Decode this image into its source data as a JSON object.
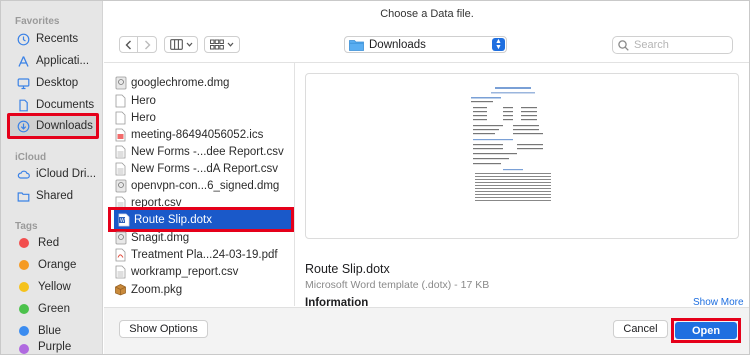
{
  "dialog": {
    "title": "Choose a Data file."
  },
  "sidebar": {
    "favorites_header": "Favorites",
    "favorites": [
      {
        "label": "Recents",
        "icon": "clock-icon"
      },
      {
        "label": "Applicati...",
        "icon": "applications-icon"
      },
      {
        "label": "Desktop",
        "icon": "desktop-icon"
      },
      {
        "label": "Documents",
        "icon": "document-icon"
      },
      {
        "label": "Downloads",
        "icon": "download-icon",
        "selected": true
      }
    ],
    "icloud_header": "iCloud",
    "icloud": [
      {
        "label": "iCloud Dri...",
        "icon": "cloud-icon"
      },
      {
        "label": "Shared",
        "icon": "shared-folder-icon"
      }
    ],
    "tags_header": "Tags",
    "tags": [
      {
        "label": "Red",
        "color": "#f24e4e"
      },
      {
        "label": "Orange",
        "color": "#f59a23"
      },
      {
        "label": "Yellow",
        "color": "#f5c21b"
      },
      {
        "label": "Green",
        "color": "#4cc24c"
      },
      {
        "label": "Blue",
        "color": "#3b8cf0"
      },
      {
        "label": "Purple",
        "color": "#b06ae0"
      }
    ]
  },
  "toolbar": {
    "location": "Downloads",
    "search_placeholder": "Search"
  },
  "files": [
    {
      "name": "googlechrome.dmg",
      "icon": "disk-image-icon"
    },
    {
      "name": "Hero",
      "icon": "file-icon"
    },
    {
      "name": "Hero",
      "icon": "file-icon"
    },
    {
      "name": "meeting-86494056052.ics",
      "icon": "calendar-file-icon"
    },
    {
      "name": "New Forms -...dee Report.csv",
      "icon": "csv-file-icon"
    },
    {
      "name": "New Forms -...dA Report.csv",
      "icon": "csv-file-icon"
    },
    {
      "name": "openvpn-con...6_signed.dmg",
      "icon": "disk-image-icon"
    },
    {
      "name": "report.csv",
      "icon": "csv-file-icon"
    },
    {
      "name": "Route Slip.dotx",
      "icon": "word-template-icon",
      "selected": true
    },
    {
      "name": "Snagit.dmg",
      "icon": "disk-image-icon"
    },
    {
      "name": "Treatment Pla...24-03-19.pdf",
      "icon": "pdf-file-icon"
    },
    {
      "name": "workramp_report.csv",
      "icon": "csv-file-icon"
    },
    {
      "name": "Zoom.pkg",
      "icon": "package-icon"
    }
  ],
  "preview": {
    "name": "Route Slip.dotx",
    "kind": "Microsoft Word template (.dotx) - 17 KB",
    "info_header": "Information",
    "show_more": "Show More"
  },
  "buttons": {
    "show_options": "Show Options",
    "cancel": "Cancel",
    "open": "Open"
  },
  "colors": {
    "accent": "#1f6fe0",
    "highlight": "#e5001a",
    "selection": "#1a59c9"
  }
}
